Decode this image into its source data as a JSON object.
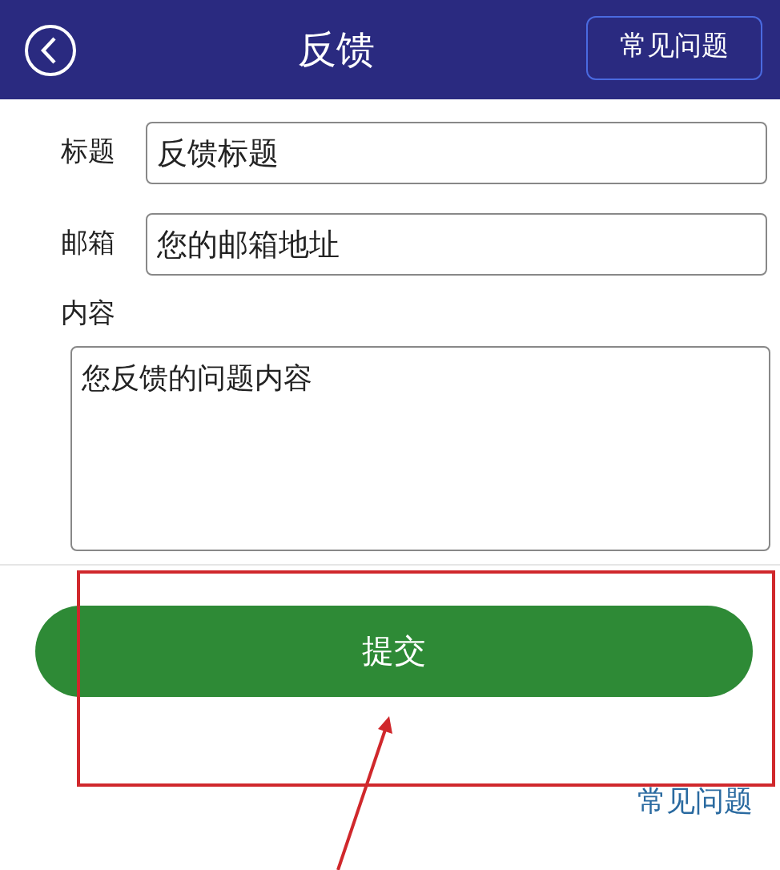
{
  "header": {
    "title": "反馈",
    "faq_button": "常见问题"
  },
  "fields": [
    {
      "kind": "input",
      "label": "标题",
      "placeholder": "反馈标题"
    },
    {
      "kind": "input",
      "label": "邮箱",
      "placeholder": "您的邮箱地址"
    },
    {
      "kind": "textarea",
      "label": "内容",
      "placeholder": "您反馈的问题内容"
    }
  ],
  "submit_button": "提交",
  "faq_link": "常见问题"
}
